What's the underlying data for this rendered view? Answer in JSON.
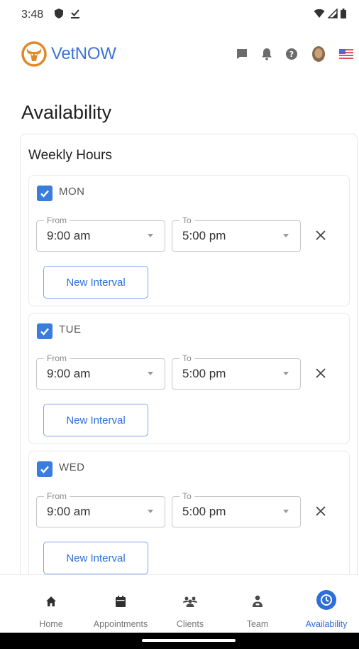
{
  "status_bar": {
    "time": "3:48"
  },
  "app": {
    "name": "VetNOW"
  },
  "page": {
    "title": "Availability",
    "section_title": "Weekly Hours"
  },
  "field_labels": {
    "from": "From",
    "to": "To"
  },
  "days": [
    {
      "label": "MON",
      "checked": true,
      "from": "9:00 am",
      "to": "5:00 pm",
      "new_interval": "New Interval"
    },
    {
      "label": "TUE",
      "checked": true,
      "from": "9:00 am",
      "to": "5:00 pm",
      "new_interval": "New Interval"
    },
    {
      "label": "WED",
      "checked": true,
      "from": "9:00 am",
      "to": "5:00 pm",
      "new_interval": "New Interval"
    }
  ],
  "nav": {
    "items": [
      {
        "label": "Home",
        "icon": "home-icon",
        "active": false
      },
      {
        "label": "Appointments",
        "icon": "calendar-icon",
        "active": false
      },
      {
        "label": "Clients",
        "icon": "people-icon",
        "active": false
      },
      {
        "label": "Team",
        "icon": "team-icon",
        "active": false
      },
      {
        "label": "Availability",
        "icon": "clock-icon",
        "active": true
      }
    ]
  },
  "colors": {
    "accent": "#3b7ddd",
    "brand": "#3b74d6",
    "logo": "#e0892a"
  }
}
